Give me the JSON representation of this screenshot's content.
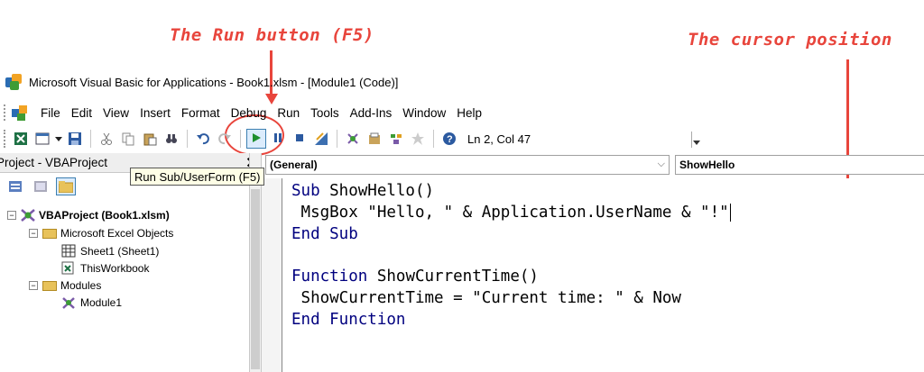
{
  "annotations": {
    "run_button": "The Run button (F5)",
    "cursor_position": "The cursor position"
  },
  "window": {
    "title": "Microsoft Visual Basic for Applications - Book1.xlsm - [Module1 (Code)]"
  },
  "menu": {
    "items": [
      "File",
      "Edit",
      "View",
      "Insert",
      "Format",
      "Debug",
      "Run",
      "Tools",
      "Add-Ins",
      "Window",
      "Help"
    ]
  },
  "toolbar": {
    "status": "Ln 2, Col 47"
  },
  "tooltip": {
    "text": "Run Sub/UserForm (F5)"
  },
  "project": {
    "title": "Project - VBAProject",
    "tree": {
      "root": "VBAProject (Book1.xlsm)",
      "excel_objects": "Microsoft Excel Objects",
      "sheet1": "Sheet1 (Sheet1)",
      "thisworkbook": "ThisWorkbook",
      "modules": "Modules",
      "module1": "Module1"
    }
  },
  "code_window": {
    "object_combo": "(General)",
    "procedure_combo": "ShowHello",
    "lines": {
      "l1_kw": "Sub",
      "l1_rest": " ShowHello()",
      "l2": " MsgBox \"Hello, \" & Application.UserName & \"!\"",
      "l3": "End Sub",
      "l5_kw": "Function",
      "l5_rest": " ShowCurrentTime()",
      "l6": " ShowCurrentTime = \"Current time: \" & Now",
      "l7": "End Function"
    }
  },
  "colors": {
    "annotation": "#e8453c",
    "keyword": "#00007f"
  }
}
